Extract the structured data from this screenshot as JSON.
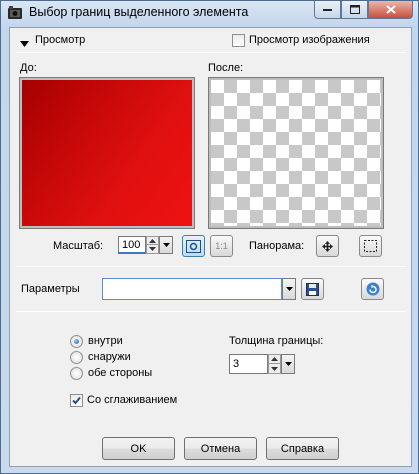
{
  "window": {
    "title": "Выбор границ выделенного элемента"
  },
  "preview": {
    "toggle_label": "Просмотр",
    "show_image_label": "Просмотр изображения",
    "show_image_checked": false,
    "before_label": "До:",
    "after_label": "После:",
    "before_color": "#cc0a0a",
    "zoom_label": "Масштаб:",
    "zoom_value": "100",
    "pan_label": "Панорама:",
    "fit_button": "1:1"
  },
  "presets": {
    "label": "Параметры",
    "value": ""
  },
  "placement": {
    "options": [
      {
        "label": "внутри",
        "selected": true
      },
      {
        "label": "снаружи",
        "selected": false
      },
      {
        "label": "обе стороны",
        "selected": false
      }
    ]
  },
  "border_width": {
    "label": "Толщина границы:",
    "value": "3"
  },
  "antialias": {
    "label": "Со сглаживанием",
    "checked": true
  },
  "buttons": {
    "ok": "OK",
    "cancel": "Отмена",
    "help": "Справка"
  }
}
